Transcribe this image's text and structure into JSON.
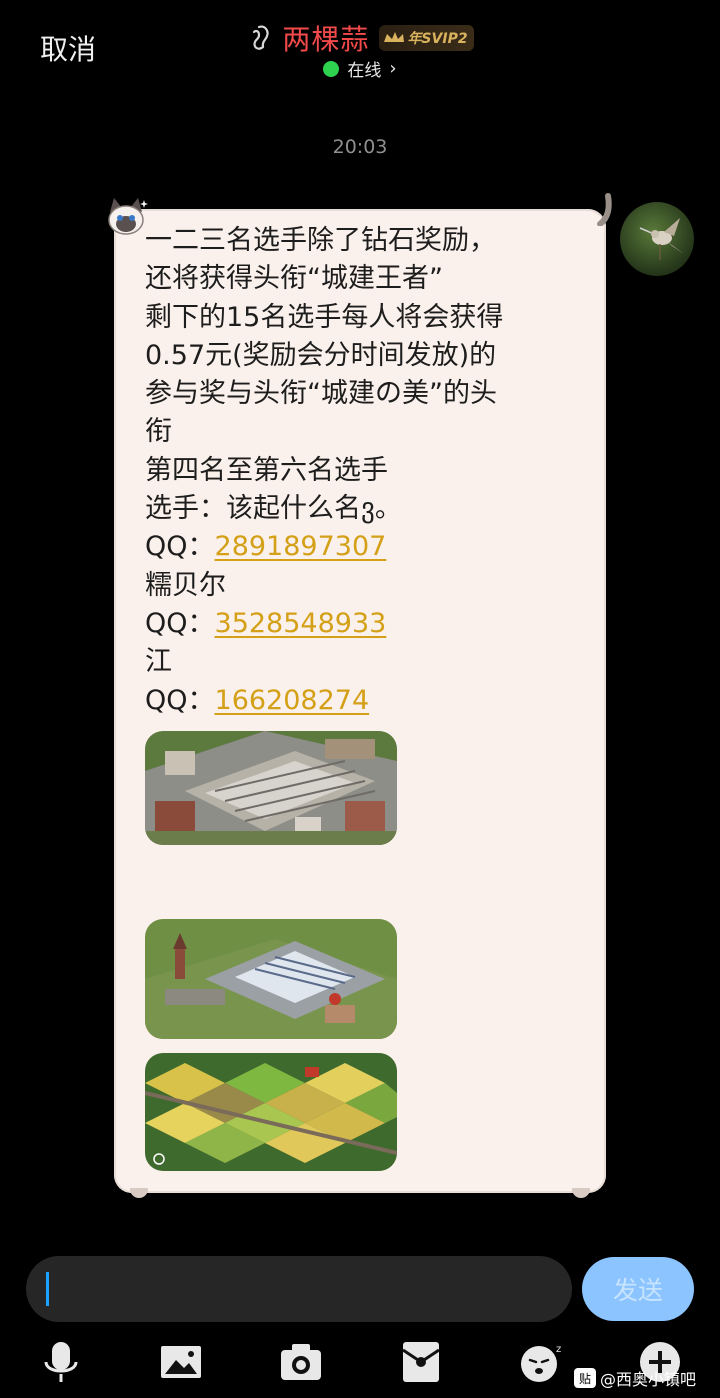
{
  "header": {
    "cancel_label": "取消",
    "contact_name": "两棵蒜",
    "vip_badge": "年SVIP2",
    "status": "在线",
    "status_chevron": "›"
  },
  "chat": {
    "timestamp": "20:03",
    "message": {
      "lines": [
        "一二三名选手除了钻石奖励，",
        "还将获得头衔“城建王者”",
        "剩下的15名选手每人将会获得",
        "0.57元(奖励会分时间发放)的",
        "参与奖与头衔“城建の美”的头",
        "衔",
        "第四名至第六名选手",
        "选手：该起什么名ვ。"
      ],
      "entries": [
        {
          "prefix": "QQ：",
          "qq": "2891897307",
          "name": "糯贝尔"
        },
        {
          "prefix": "QQ：",
          "qq": "3528548933",
          "name": "江"
        },
        {
          "prefix": "QQ：",
          "qq": "166208274",
          "name": ""
        }
      ]
    }
  },
  "input": {
    "send_label": "发送"
  },
  "toolbar": {
    "icons": [
      "microphone-icon",
      "image-icon",
      "camera-icon",
      "red-packet-icon",
      "emoji-icon",
      "plus-icon"
    ]
  },
  "watermark": {
    "logo": "贴",
    "text": "@西奥小镇吧"
  },
  "colors": {
    "background": "#000000",
    "contact_name": "#f24a4a",
    "online_dot": "#2fd24f",
    "bubble": "#fbf1ec",
    "link": "#d4a017",
    "send_button": "#8cc4ff"
  }
}
